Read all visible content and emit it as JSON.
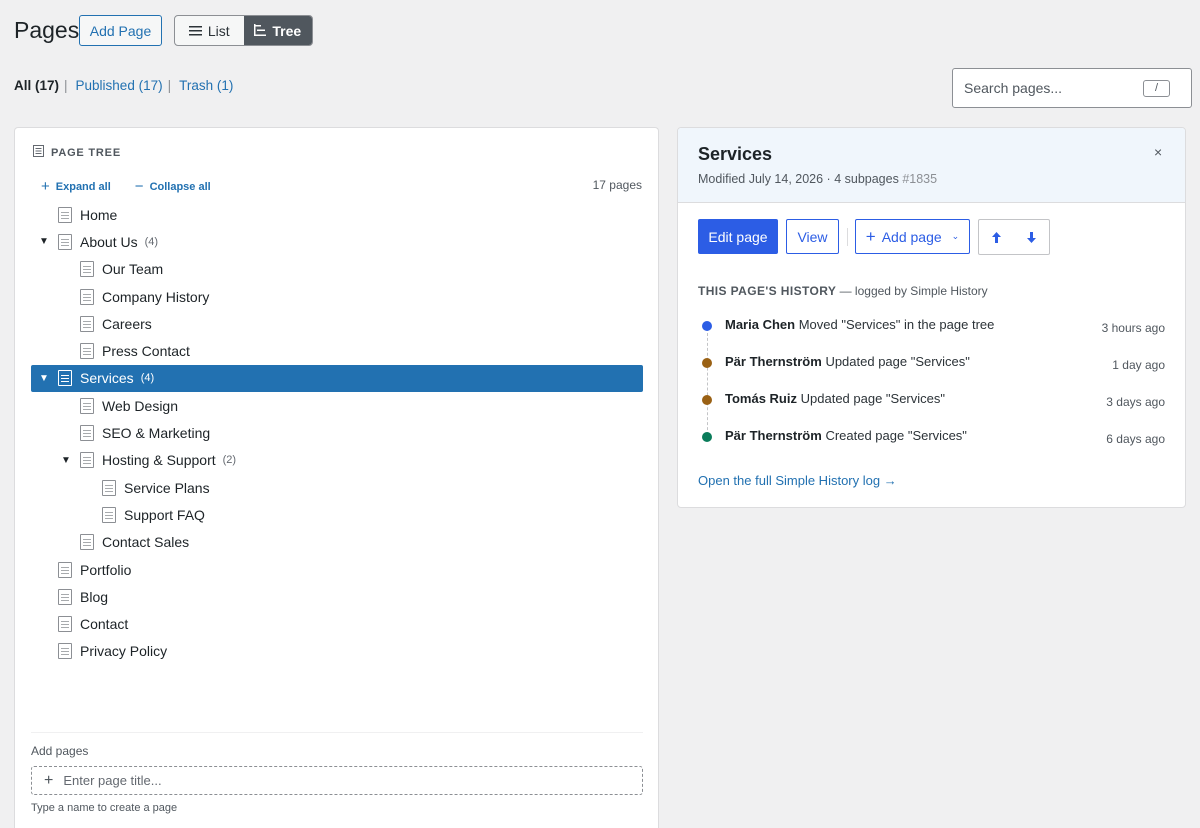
{
  "header": {
    "title": "Pages",
    "add_button": "Add Page",
    "view_list": "List",
    "view_tree": "Tree"
  },
  "filters": {
    "all": "All (17)",
    "published": "Published (17)",
    "trash": "Trash (1)",
    "sep": "|"
  },
  "search": {
    "placeholder": "Search pages...",
    "shortcut": "/"
  },
  "tree": {
    "heading": "PAGE TREE",
    "expand_all": "Expand all",
    "collapse_all": "Collapse all",
    "count": "17 pages",
    "rows": [
      {
        "label": "Home",
        "count": "",
        "level": 0,
        "toggle": ""
      },
      {
        "label": "About Us",
        "count": "(4)",
        "level": 0,
        "toggle": "▼"
      },
      {
        "label": "Our Team",
        "count": "",
        "level": 1,
        "toggle": ""
      },
      {
        "label": "Company History",
        "count": "",
        "level": 1,
        "toggle": ""
      },
      {
        "label": "Careers",
        "count": "",
        "level": 1,
        "toggle": ""
      },
      {
        "label": "Press Contact",
        "count": "",
        "level": 1,
        "toggle": ""
      },
      {
        "label": "Services",
        "count": "(4)",
        "level": 0,
        "toggle": "▼",
        "selected": true
      },
      {
        "label": "Web Design",
        "count": "",
        "level": 1,
        "toggle": ""
      },
      {
        "label": "SEO & Marketing",
        "count": "",
        "level": 1,
        "toggle": ""
      },
      {
        "label": "Hosting & Support",
        "count": "(2)",
        "level": 1,
        "toggle": "▼"
      },
      {
        "label": "Service Plans",
        "count": "",
        "level": 2,
        "toggle": ""
      },
      {
        "label": "Support FAQ",
        "count": "",
        "level": 2,
        "toggle": ""
      },
      {
        "label": "Contact Sales",
        "count": "",
        "level": 1,
        "toggle": ""
      },
      {
        "label": "Portfolio",
        "count": "",
        "level": 0,
        "toggle": ""
      },
      {
        "label": "Blog",
        "count": "",
        "level": 0,
        "toggle": ""
      },
      {
        "label": "Contact",
        "count": "",
        "level": 0,
        "toggle": ""
      },
      {
        "label": "Privacy Policy",
        "count": "",
        "level": 0,
        "toggle": ""
      }
    ],
    "add_label": "Add pages",
    "add_placeholder": "Enter page title...",
    "add_help": "Type a name to create a page"
  },
  "detail": {
    "title": "Services",
    "meta": "Modified July 14, 2026 · 4 subpages",
    "page_id": "#1835",
    "close": "×",
    "edit_button": "Edit page",
    "view_button": "View",
    "add_button": "Add page",
    "history_heading": "THIS PAGE'S HISTORY",
    "history_sub": " — logged by Simple History",
    "history": [
      {
        "user": "Maria Chen",
        "action": "Moved \"Services\" in the page tree",
        "when": "3 hours ago",
        "color": "#2c5de5"
      },
      {
        "user": "Pär Thernström",
        "action": "Updated page \"Services\"",
        "when": "1 day ago",
        "color": "#9a6114"
      },
      {
        "user": "Tomás Ruiz",
        "action": "Updated page \"Services\"",
        "when": "3 days ago",
        "color": "#9a6114"
      },
      {
        "user": "Pär Thernström",
        "action": "Created page \"Services\"",
        "when": "6 days ago",
        "color": "#0a7c5a"
      }
    ],
    "history_link": "Open the full Simple History log →"
  }
}
